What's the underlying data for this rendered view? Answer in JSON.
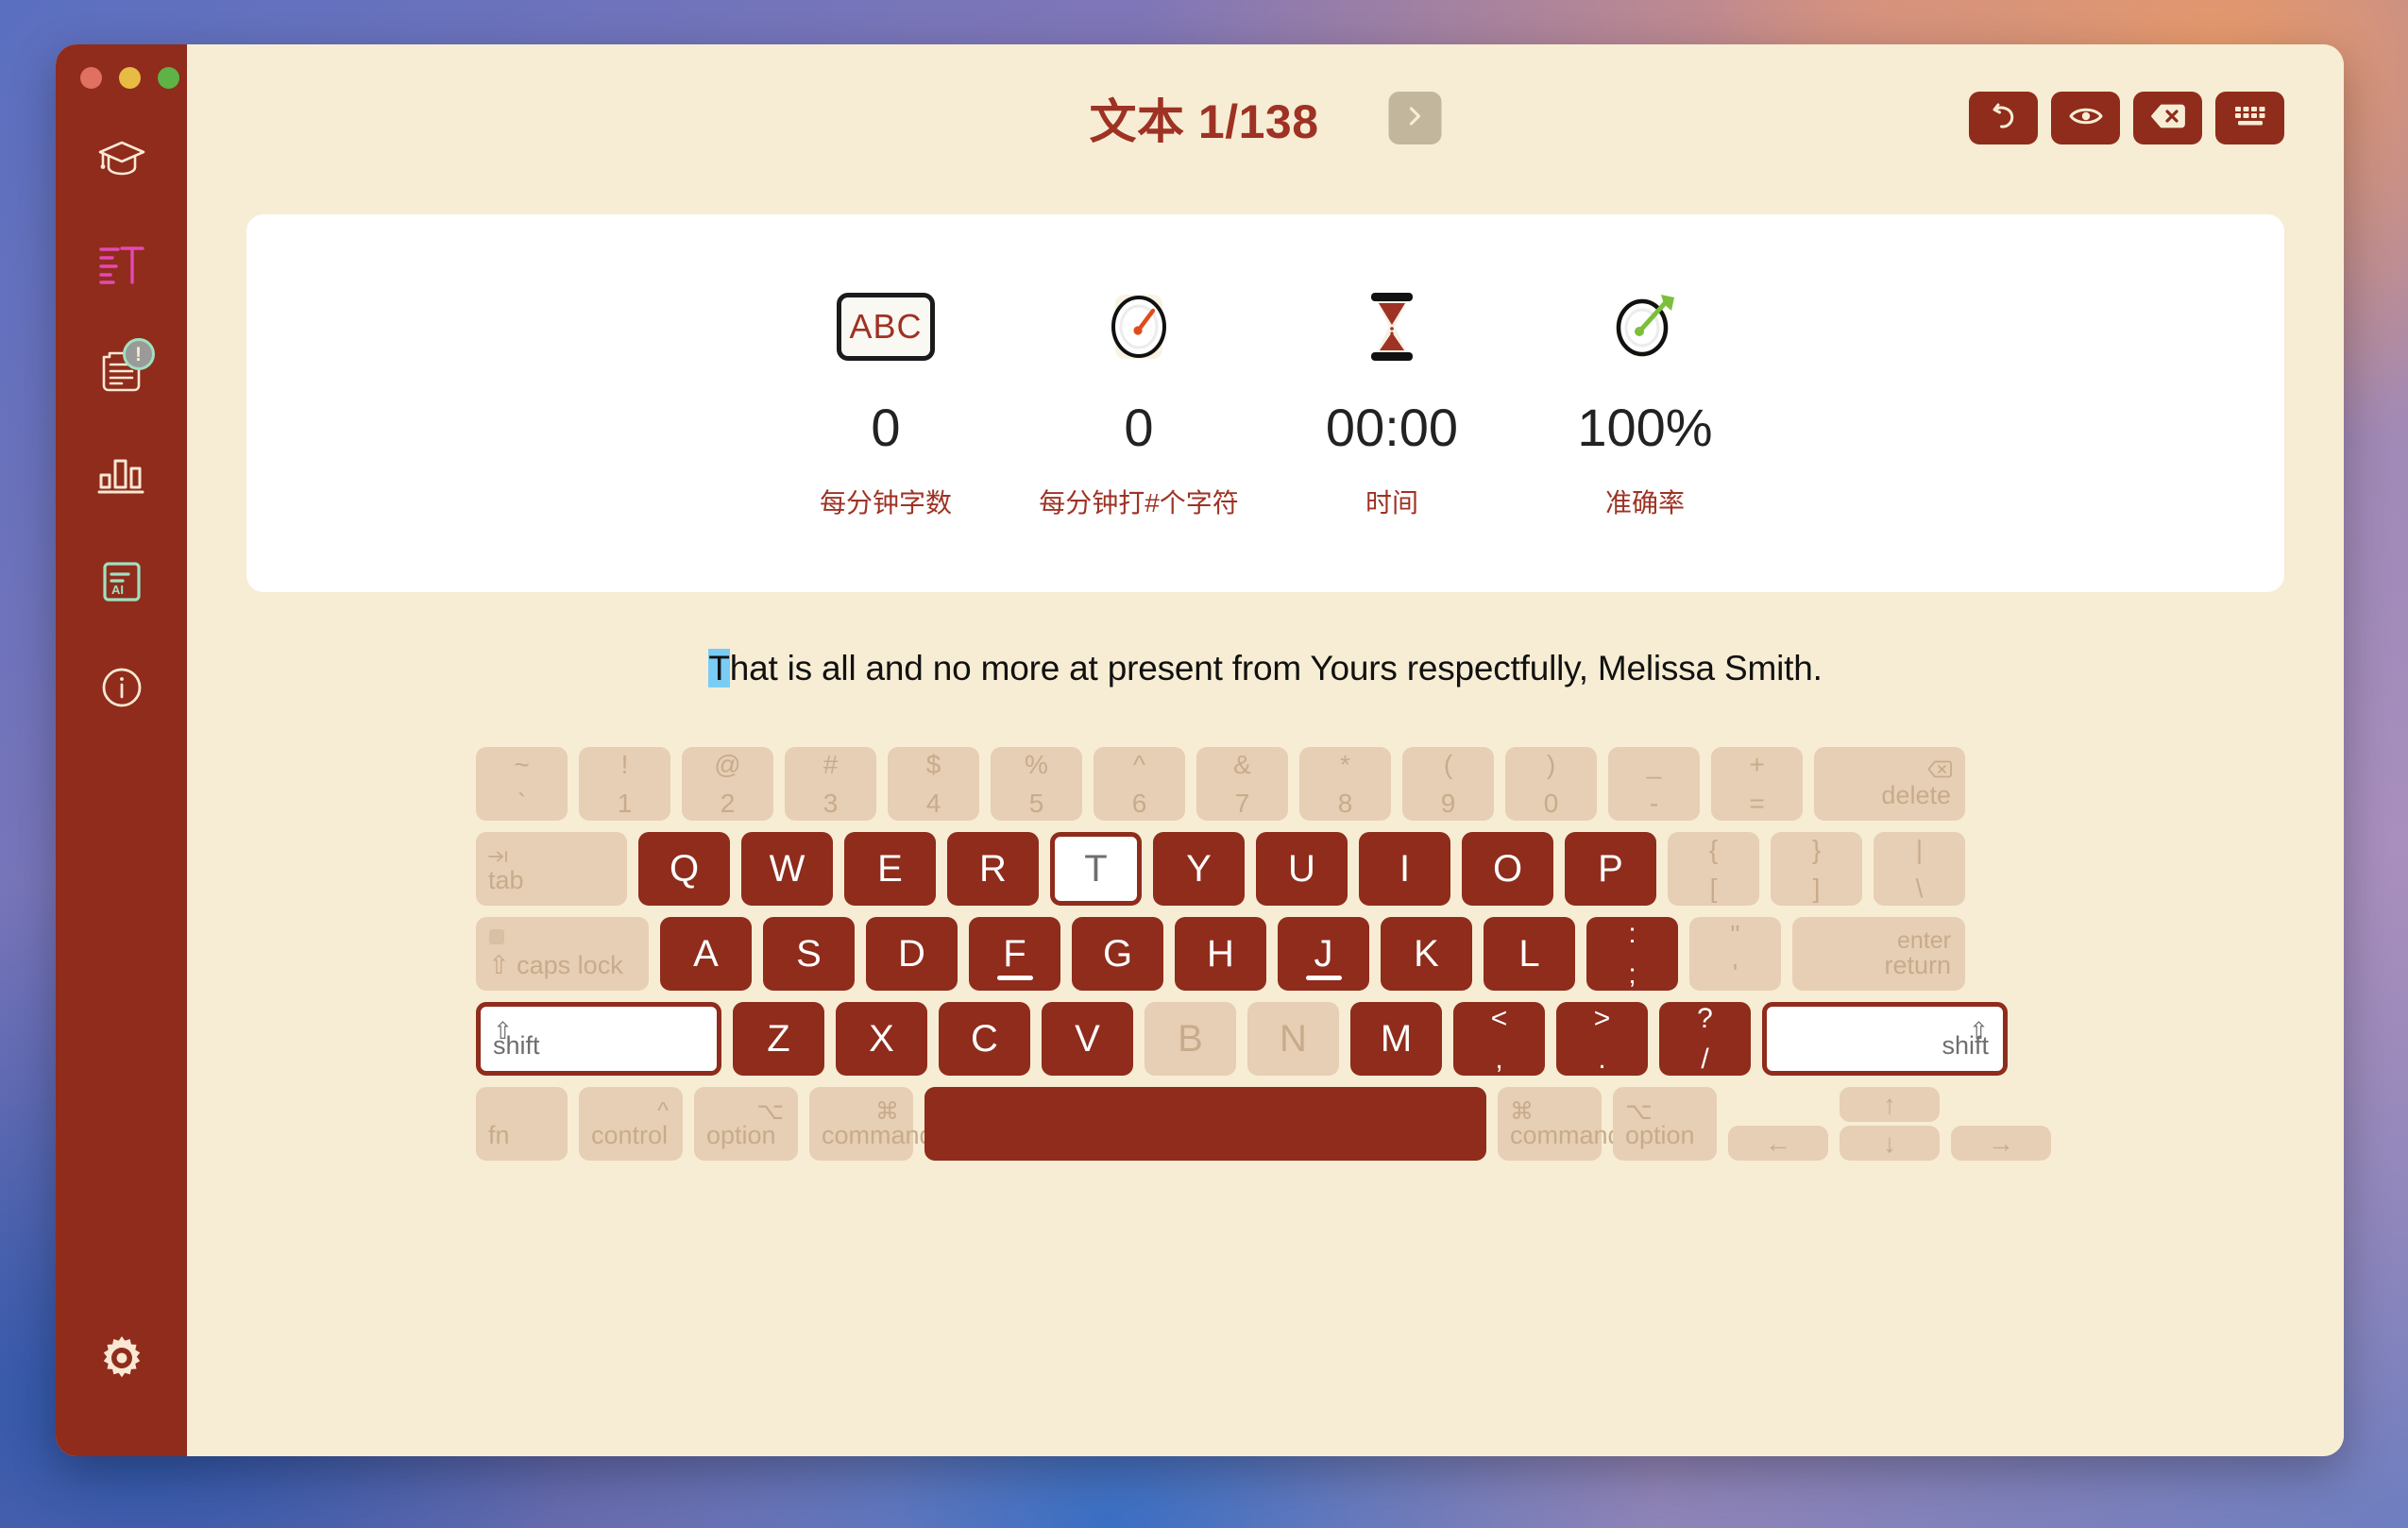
{
  "window": {
    "traffic_lights": [
      "close",
      "minimize",
      "maximize"
    ]
  },
  "sidebar": {
    "items": [
      {
        "icon": "graduation-cap-icon",
        "name": "lessons"
      },
      {
        "icon": "text-paragraph-icon",
        "name": "text-practice"
      },
      {
        "icon": "clipboard-notes-icon",
        "name": "documents",
        "badge": "!"
      },
      {
        "icon": "bar-chart-icon",
        "name": "statistics"
      },
      {
        "icon": "ai-document-icon",
        "name": "ai-text"
      },
      {
        "icon": "info-circle-icon",
        "name": "about"
      }
    ],
    "settings": {
      "icon": "gear-icon",
      "name": "settings"
    }
  },
  "header": {
    "title": "文本 1/138",
    "next_button_label": "›",
    "toolbar": [
      {
        "name": "restart",
        "icon": "undo-arrow-icon"
      },
      {
        "name": "preview",
        "icon": "eye-icon"
      },
      {
        "name": "clear",
        "icon": "backspace-x-icon"
      },
      {
        "name": "toggle-keyboard",
        "icon": "keyboard-icon"
      }
    ]
  },
  "stats": [
    {
      "icon": "abc-box-icon",
      "icon_text": "ABC",
      "value": "0",
      "label": "每分钟字数"
    },
    {
      "icon": "speedometer-icon",
      "value": "0",
      "label": "每分钟打#个字符"
    },
    {
      "icon": "hourglass-icon",
      "value": "00:00",
      "label": "时间"
    },
    {
      "icon": "target-dart-icon",
      "value": "100%",
      "label": "准确率"
    }
  ],
  "prompt": {
    "cursor_char": "T",
    "rest": "hat is all and no more at present from Yours respectfully, Melissa Smith."
  },
  "keyboard": {
    "rows": [
      [
        {
          "n": "key-backtick",
          "top": "~",
          "bottom": "`",
          "state": "dim",
          "w": ""
        },
        {
          "n": "key-1",
          "top": "!",
          "bottom": "1",
          "state": "dim",
          "w": ""
        },
        {
          "n": "key-2",
          "top": "@",
          "bottom": "2",
          "state": "dim",
          "w": ""
        },
        {
          "n": "key-3",
          "top": "#",
          "bottom": "3",
          "state": "dim",
          "w": ""
        },
        {
          "n": "key-4",
          "top": "$",
          "bottom": "4",
          "state": "dim",
          "w": ""
        },
        {
          "n": "key-5",
          "top": "%",
          "bottom": "5",
          "state": "dim",
          "w": ""
        },
        {
          "n": "key-6",
          "top": "^",
          "bottom": "6",
          "state": "dim",
          "w": ""
        },
        {
          "n": "key-7",
          "top": "&",
          "bottom": "7",
          "state": "dim",
          "w": ""
        },
        {
          "n": "key-8",
          "top": "*",
          "bottom": "8",
          "state": "dim",
          "w": ""
        },
        {
          "n": "key-9",
          "top": "(",
          "bottom": "9",
          "state": "dim",
          "w": ""
        },
        {
          "n": "key-0",
          "top": ")",
          "bottom": "0",
          "state": "dim",
          "w": ""
        },
        {
          "n": "key-minus",
          "top": "_",
          "bottom": "-",
          "state": "dim",
          "w": ""
        },
        {
          "n": "key-equals",
          "top": "+",
          "bottom": "=",
          "state": "dim",
          "w": ""
        },
        {
          "n": "key-delete",
          "label": "delete",
          "icon": "backspace-icon",
          "state": "dim",
          "w": "k-del"
        }
      ],
      [
        {
          "n": "key-tab",
          "label": "tab",
          "icon": "tab-arrow-icon",
          "state": "dim",
          "w": "k-tab"
        },
        {
          "n": "key-q",
          "letter": "Q",
          "state": "active",
          "w": ""
        },
        {
          "n": "key-w",
          "letter": "W",
          "state": "active",
          "w": ""
        },
        {
          "n": "key-e",
          "letter": "E",
          "state": "active",
          "w": ""
        },
        {
          "n": "key-r",
          "letter": "R",
          "state": "active",
          "w": ""
        },
        {
          "n": "key-t",
          "letter": "T",
          "state": "hl",
          "w": ""
        },
        {
          "n": "key-y",
          "letter": "Y",
          "state": "active",
          "w": ""
        },
        {
          "n": "key-u",
          "letter": "U",
          "state": "active",
          "w": ""
        },
        {
          "n": "key-i",
          "letter": "I",
          "state": "active",
          "w": ""
        },
        {
          "n": "key-o",
          "letter": "O",
          "state": "active",
          "w": ""
        },
        {
          "n": "key-p",
          "letter": "P",
          "state": "active",
          "w": ""
        },
        {
          "n": "key-bracket-left",
          "top": "{",
          "bottom": "[",
          "state": "dim",
          "w": ""
        },
        {
          "n": "key-bracket-right",
          "top": "}",
          "bottom": "]",
          "state": "dim",
          "w": ""
        },
        {
          "n": "key-backslash",
          "top": "|",
          "bottom": "\\",
          "state": "dim",
          "w": ""
        }
      ],
      [
        {
          "n": "key-caps-lock",
          "label": "caps lock",
          "icon": "caps-lock-icon",
          "state": "dim",
          "w": "k-caps"
        },
        {
          "n": "key-a",
          "letter": "A",
          "state": "active",
          "w": ""
        },
        {
          "n": "key-s",
          "letter": "S",
          "state": "active",
          "w": ""
        },
        {
          "n": "key-d",
          "letter": "D",
          "state": "active",
          "w": ""
        },
        {
          "n": "key-f",
          "letter": "F",
          "state": "active",
          "home": true,
          "w": ""
        },
        {
          "n": "key-g",
          "letter": "G",
          "state": "active",
          "w": ""
        },
        {
          "n": "key-h",
          "letter": "H",
          "state": "active",
          "w": ""
        },
        {
          "n": "key-j",
          "letter": "J",
          "state": "active",
          "home": true,
          "w": ""
        },
        {
          "n": "key-k",
          "letter": "K",
          "state": "active",
          "w": ""
        },
        {
          "n": "key-l",
          "letter": "L",
          "state": "active",
          "w": ""
        },
        {
          "n": "key-semicolon",
          "top": ":",
          "bottom": ";",
          "state": "active",
          "w": ""
        },
        {
          "n": "key-quote",
          "top": "\"",
          "bottom": "'",
          "state": "dim",
          "w": ""
        },
        {
          "n": "key-return",
          "label": "return",
          "sublabel": "enter",
          "state": "dim",
          "w": "k-enter"
        }
      ],
      [
        {
          "n": "key-shift-left",
          "label": "shift",
          "icon": "shift-arrow-icon",
          "state": "hl",
          "w": "k-shift-l"
        },
        {
          "n": "key-z",
          "letter": "Z",
          "state": "active",
          "w": ""
        },
        {
          "n": "key-x",
          "letter": "X",
          "state": "active",
          "w": ""
        },
        {
          "n": "key-c",
          "letter": "C",
          "state": "active",
          "w": ""
        },
        {
          "n": "key-v",
          "letter": "V",
          "state": "active",
          "w": ""
        },
        {
          "n": "key-b",
          "letter": "B",
          "state": "dim",
          "w": ""
        },
        {
          "n": "key-n",
          "letter": "N",
          "state": "dim",
          "w": ""
        },
        {
          "n": "key-m",
          "letter": "M",
          "state": "active",
          "w": ""
        },
        {
          "n": "key-comma",
          "top": "<",
          "bottom": ",",
          "state": "active",
          "w": ""
        },
        {
          "n": "key-period",
          "top": ">",
          "bottom": ".",
          "state": "active",
          "w": ""
        },
        {
          "n": "key-slash",
          "top": "?",
          "bottom": "/",
          "state": "active",
          "w": ""
        },
        {
          "n": "key-shift-right",
          "label": "shift",
          "icon": "shift-arrow-icon",
          "state": "hl",
          "align": "right",
          "w": "k-shift-r"
        }
      ],
      [
        {
          "n": "key-fn",
          "label": "fn",
          "state": "dim",
          "w": "k-fn"
        },
        {
          "n": "key-control",
          "label": "control",
          "icon": "^",
          "state": "dim",
          "w": "k-mod"
        },
        {
          "n": "key-option-left",
          "label": "option",
          "icon": "⌥",
          "state": "dim",
          "w": "k-mod"
        },
        {
          "n": "key-command-left",
          "label": "command",
          "icon": "⌘",
          "state": "dim",
          "w": "k-mod"
        },
        {
          "n": "key-space",
          "label": "",
          "state": "active",
          "w": "k-space"
        },
        {
          "n": "key-command-right",
          "label": "command",
          "icon": "⌘",
          "state": "dim",
          "w": "k-mod"
        },
        {
          "n": "key-option-right",
          "label": "option",
          "icon": "⌥",
          "state": "dim",
          "w": "k-mod"
        }
      ]
    ],
    "arrows": {
      "left": "←",
      "up": "↑",
      "down": "↓",
      "right": "→"
    }
  },
  "colors": {
    "brand_red": "#8f2c1c",
    "title_red": "#9e3224",
    "cream": "#f7edd4",
    "key_inactive": "#e6cfb4",
    "cursor_highlight": "#79cdf5",
    "accent_pink": "#e549b4",
    "accent_green": "#9fe0c0"
  }
}
